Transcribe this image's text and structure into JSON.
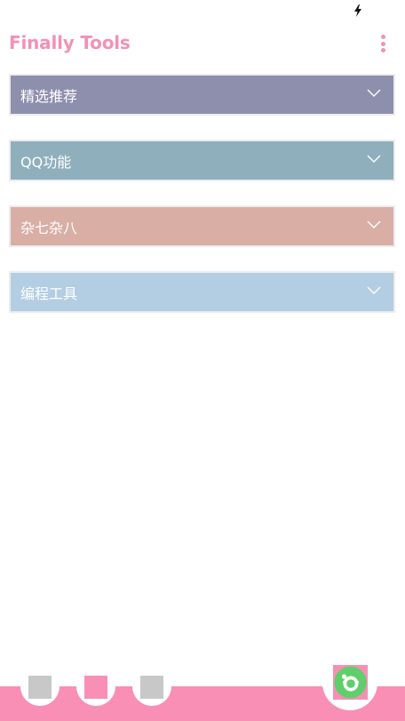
{
  "app": {
    "title": "Finally Tools"
  },
  "sections": [
    {
      "label": "精选推荐",
      "color": "#8e8fad"
    },
    {
      "label": "QQ功能",
      "color": "#8fafbc"
    },
    {
      "label": "杂七杂八",
      "color": "#d9aea5"
    },
    {
      "label": "编程工具",
      "color": "#b3cee3"
    }
  ],
  "bottom_nav": {
    "accent": "#f98fb5",
    "inactive": "#c8c8c8",
    "tabs": [
      {
        "icon": "square-icon",
        "active": false
      },
      {
        "icon": "square-icon",
        "active": true
      },
      {
        "icon": "square-icon",
        "active": false
      }
    ]
  },
  "icons": {
    "status": "lightning-bolt-icon",
    "menu": "more-vertical-icon",
    "section_toggle": "chevron-down-icon",
    "fab": "smiley-badge-icon"
  }
}
